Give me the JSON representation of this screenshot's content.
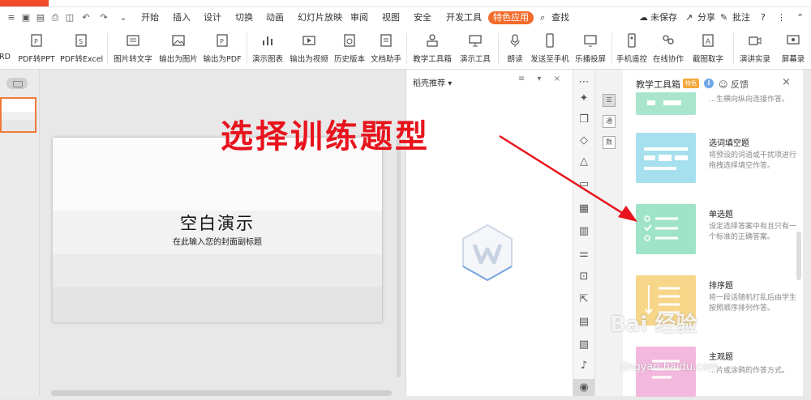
{
  "menu": {
    "items": [
      "开始",
      "插入",
      "设计",
      "切换",
      "动画",
      "幻灯片放映",
      "审阅",
      "视图",
      "安全",
      "开发工具"
    ],
    "special": "特色应用",
    "search": "查找",
    "right": {
      "unsaved": "未保存",
      "share": "分享",
      "comment": "批注",
      "help": "?"
    }
  },
  "ribbon": {
    "buttons": [
      "RD",
      "PDF转PPT",
      "PDF转Excel",
      "图片转文字",
      "输出为图片",
      "输出为PDF",
      "演示图表",
      "输出为视频",
      "历史版本",
      "文档助手",
      "教学工具箱",
      "演示工具",
      "朗读",
      "发送至手机",
      "乐播投屏",
      "手机遥控",
      "在线协作",
      "截图取字",
      "演讲实录",
      "屏幕录"
    ]
  },
  "slide": {
    "title": "空白演示",
    "subtitle": "在此输入您的封面副标题"
  },
  "rec_pane": {
    "title": "稻壳推荐",
    "dropdown": "▾",
    "controls": "≡ ▾ ×"
  },
  "side_tabs": [
    "☰",
    "通",
    "数"
  ],
  "toolbox": {
    "title": "教学工具箱",
    "badge": "特色",
    "info": "i",
    "feedback": "反馈",
    "close": "×",
    "cards": [
      {
        "title": "",
        "desc": "…生横向纵向连接作答。",
        "color": "#a9e5cd"
      },
      {
        "title": "选词填空题",
        "desc": "将预设的词语或干扰项进行拖拽选择填空作答。",
        "color": "#a6e0ee"
      },
      {
        "title": "单选题",
        "desc": "设定选择答案中有且只有一个标准的正确答案。",
        "color": "#9fe4c8"
      },
      {
        "title": "排序题",
        "desc": "将一段话随机打乱后由学生按照顺序排列作答。",
        "color": "#f7d68a"
      },
      {
        "title": "主观题",
        "desc": "…片或涂鸦的作答方式。",
        "color": "#f3b8de"
      }
    ]
  },
  "annotation": {
    "text": "选择训练题型"
  },
  "watermark": {
    "text": "Bai 经验",
    "sub": "jingyan.baidu.com"
  },
  "colors": {
    "accent": "#f26b2a",
    "annotation": "#e8141d",
    "selected_thumb_border": "#f07a3a"
  }
}
